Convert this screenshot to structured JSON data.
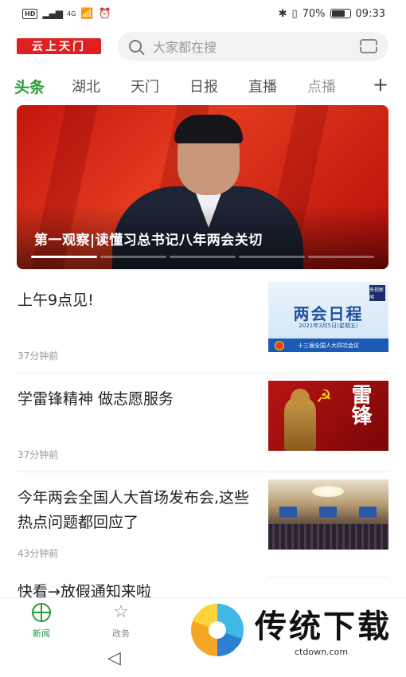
{
  "status_bar": {
    "network": "HD",
    "signal": "4G",
    "battery": "70%",
    "time": "09:33"
  },
  "header": {
    "logo": "云上天门",
    "search_placeholder": "大家都在搜"
  },
  "tabs": [
    {
      "label": "头条",
      "active": true
    },
    {
      "label": "湖北"
    },
    {
      "label": "天门"
    },
    {
      "label": "日报"
    },
    {
      "label": "直播"
    },
    {
      "label": "点播"
    }
  ],
  "tabs_add": "+",
  "banner": {
    "title": "第一观察|读懂习总书记八年两会关切",
    "slides": 5,
    "active_slide": 1
  },
  "news": [
    {
      "title": "上午9点见!",
      "time": "37分钟前",
      "thumb": {
        "heading": "两会日程",
        "date": "2021年3月5日(星期五)",
        "footer": "十三届全国人大四次会议",
        "badge": "央视新闻"
      }
    },
    {
      "title": "学雷锋精神 做志愿服务",
      "time": "37分钟前",
      "thumb": {
        "calligraphy": "雷锋"
      }
    },
    {
      "title": "今年两会全国人大首场发布会,这些热点问题都回应了",
      "time": "43分钟前",
      "thumb": {}
    },
    {
      "title": "快看→放假通知来啦",
      "time": ""
    }
  ],
  "bottom_nav": [
    {
      "label": "新闻",
      "active": true
    },
    {
      "label": "政务"
    }
  ],
  "watermark": {
    "brand": "传统下载",
    "url": "ctdown.com"
  },
  "colors": {
    "accent_green": "#2a9a3a",
    "logo_red": "#e02020"
  }
}
